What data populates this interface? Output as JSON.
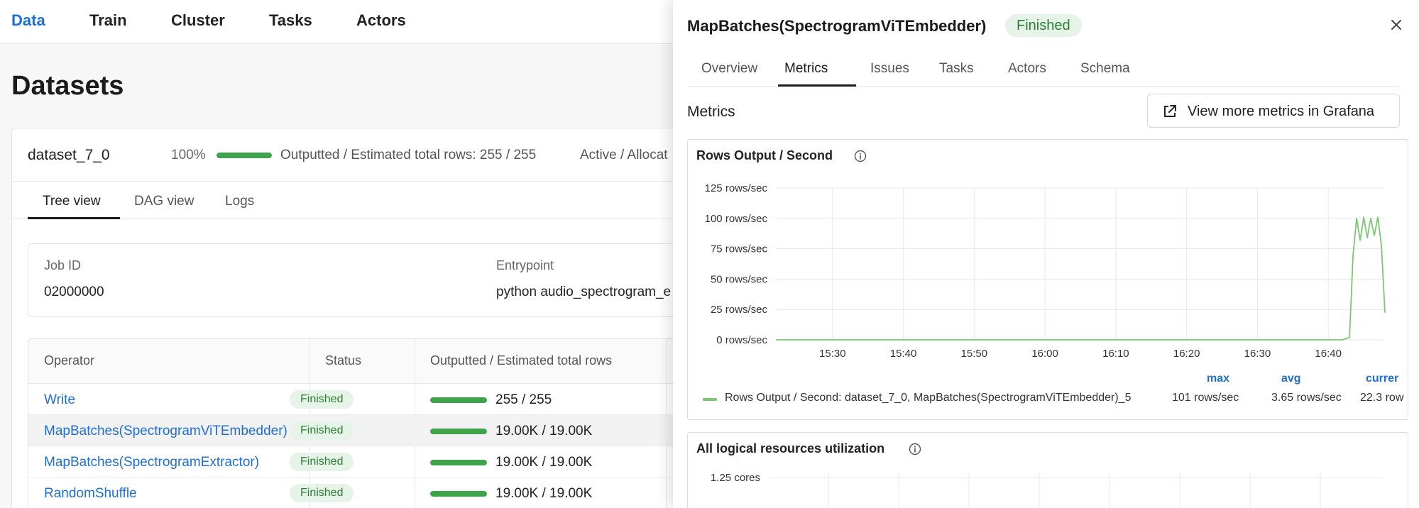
{
  "nav": {
    "items": [
      {
        "label": "Data",
        "active": true
      },
      {
        "label": "Train",
        "active": false
      },
      {
        "label": "Cluster",
        "active": false
      },
      {
        "label": "Tasks",
        "active": false
      },
      {
        "label": "Actors",
        "active": false
      }
    ]
  },
  "page": {
    "title": "Datasets"
  },
  "dataset": {
    "name": "dataset_7_0",
    "percent": "100%",
    "progress": 1.0,
    "rows_label": "Outputted / Estimated total rows: 255 / 255",
    "active_label": "Active / Allocat",
    "tabs": [
      "Tree view",
      "DAG view",
      "Logs"
    ],
    "active_tab": "Tree view",
    "job": {
      "job_id_label": "Job ID",
      "job_id": "02000000",
      "entrypoint_label": "Entrypoint",
      "entrypoint": "python audio_spectrogram_e"
    },
    "table": {
      "headers": [
        "Operator",
        "Status",
        "Outputted / Estimated total rows"
      ],
      "rows": [
        {
          "operator": "Write",
          "status": "Finished",
          "rows": "255 / 255",
          "progress": 1.0
        },
        {
          "operator": "MapBatches(SpectrogramViTEmbedder)",
          "status": "Finished",
          "rows": "19.00K / 19.00K",
          "progress": 1.0
        },
        {
          "operator": "MapBatches(SpectrogramExtractor)",
          "status": "Finished",
          "rows": "19.00K / 19.00K",
          "progress": 1.0
        },
        {
          "operator": "RandomShuffle",
          "status": "Finished",
          "rows": "19.00K / 19.00K",
          "progress": 1.0
        }
      ]
    }
  },
  "drawer": {
    "title": "MapBatches(SpectrogramViTEmbedder)",
    "status": "Finished",
    "tabs": [
      "Overview",
      "Metrics",
      "Issues",
      "Tasks",
      "Actors",
      "Schema"
    ],
    "active_tab": "Metrics",
    "section_label": "Metrics",
    "grafana_button": "View more metrics in Grafana",
    "panels": {
      "rows_output": {
        "title": "Rows Output / Second",
        "legend": "Rows Output / Second: dataset_7_0, MapBatches(SpectrogramViTEmbedder)_5",
        "stats": [
          {
            "label": "max",
            "value": "101 rows/sec"
          },
          {
            "label": "avg",
            "value": "3.65 rows/sec"
          },
          {
            "label": "currer",
            "value": "22.3 row"
          }
        ]
      },
      "logical_resources": {
        "title": "All logical resources utilization",
        "first_tick": "1.25 cores"
      }
    }
  },
  "colors": {
    "accent": "#1f6fd1",
    "success": "#3ea34a",
    "series": "#7cc774"
  },
  "chart_data": {
    "type": "line",
    "title": "Rows Output / Second",
    "xlabel": "",
    "ylabel": "",
    "x_ticks": [
      "15:30",
      "15:40",
      "15:50",
      "16:00",
      "16:10",
      "16:20",
      "16:30",
      "16:40"
    ],
    "y_ticks": [
      "0 rows/sec",
      "25 rows/sec",
      "50 rows/sec",
      "75 rows/sec",
      "100 rows/sec",
      "125 rows/sec"
    ],
    "ylim": [
      0,
      125
    ],
    "xlim": [
      "15:22",
      "16:48"
    ],
    "grid": true,
    "legend": "bottom-left",
    "series": [
      {
        "name": "Rows Output / Second: dataset_7_0, MapBatches(SpectrogramViTEmbedder)_5",
        "x": [
          "15:22",
          "16:42",
          "16:43",
          "16:43.5",
          "16:44",
          "16:44.5",
          "16:45",
          "16:45.5",
          "16:46",
          "16:46.5",
          "16:47",
          "16:47.5",
          "16:48"
        ],
        "values": [
          0,
          0,
          2,
          70,
          100,
          82,
          101,
          84,
          100,
          86,
          101,
          78,
          22.3
        ]
      }
    ]
  }
}
